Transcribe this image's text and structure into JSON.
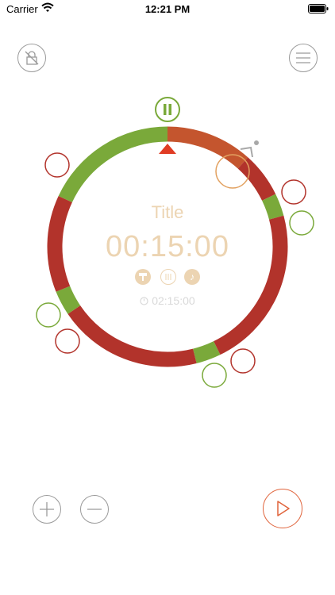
{
  "status_bar": {
    "carrier": "Carrier",
    "time": "12:21 PM"
  },
  "timer": {
    "title": "Title",
    "remaining": "00:15:00",
    "total": "02:15:00"
  },
  "colors": {
    "green": "#7aa93a",
    "red": "#b2332b",
    "orange_red": "#c4552e",
    "cream": "#ecd4b2",
    "grey": "#9a9a9a",
    "play_orange": "#e0643c"
  },
  "icons": {
    "lock": "lock-icon",
    "menu": "menu-icon",
    "pause": "pause-icon",
    "play": "play-icon",
    "add": "plus-icon",
    "remove": "minus-icon"
  }
}
